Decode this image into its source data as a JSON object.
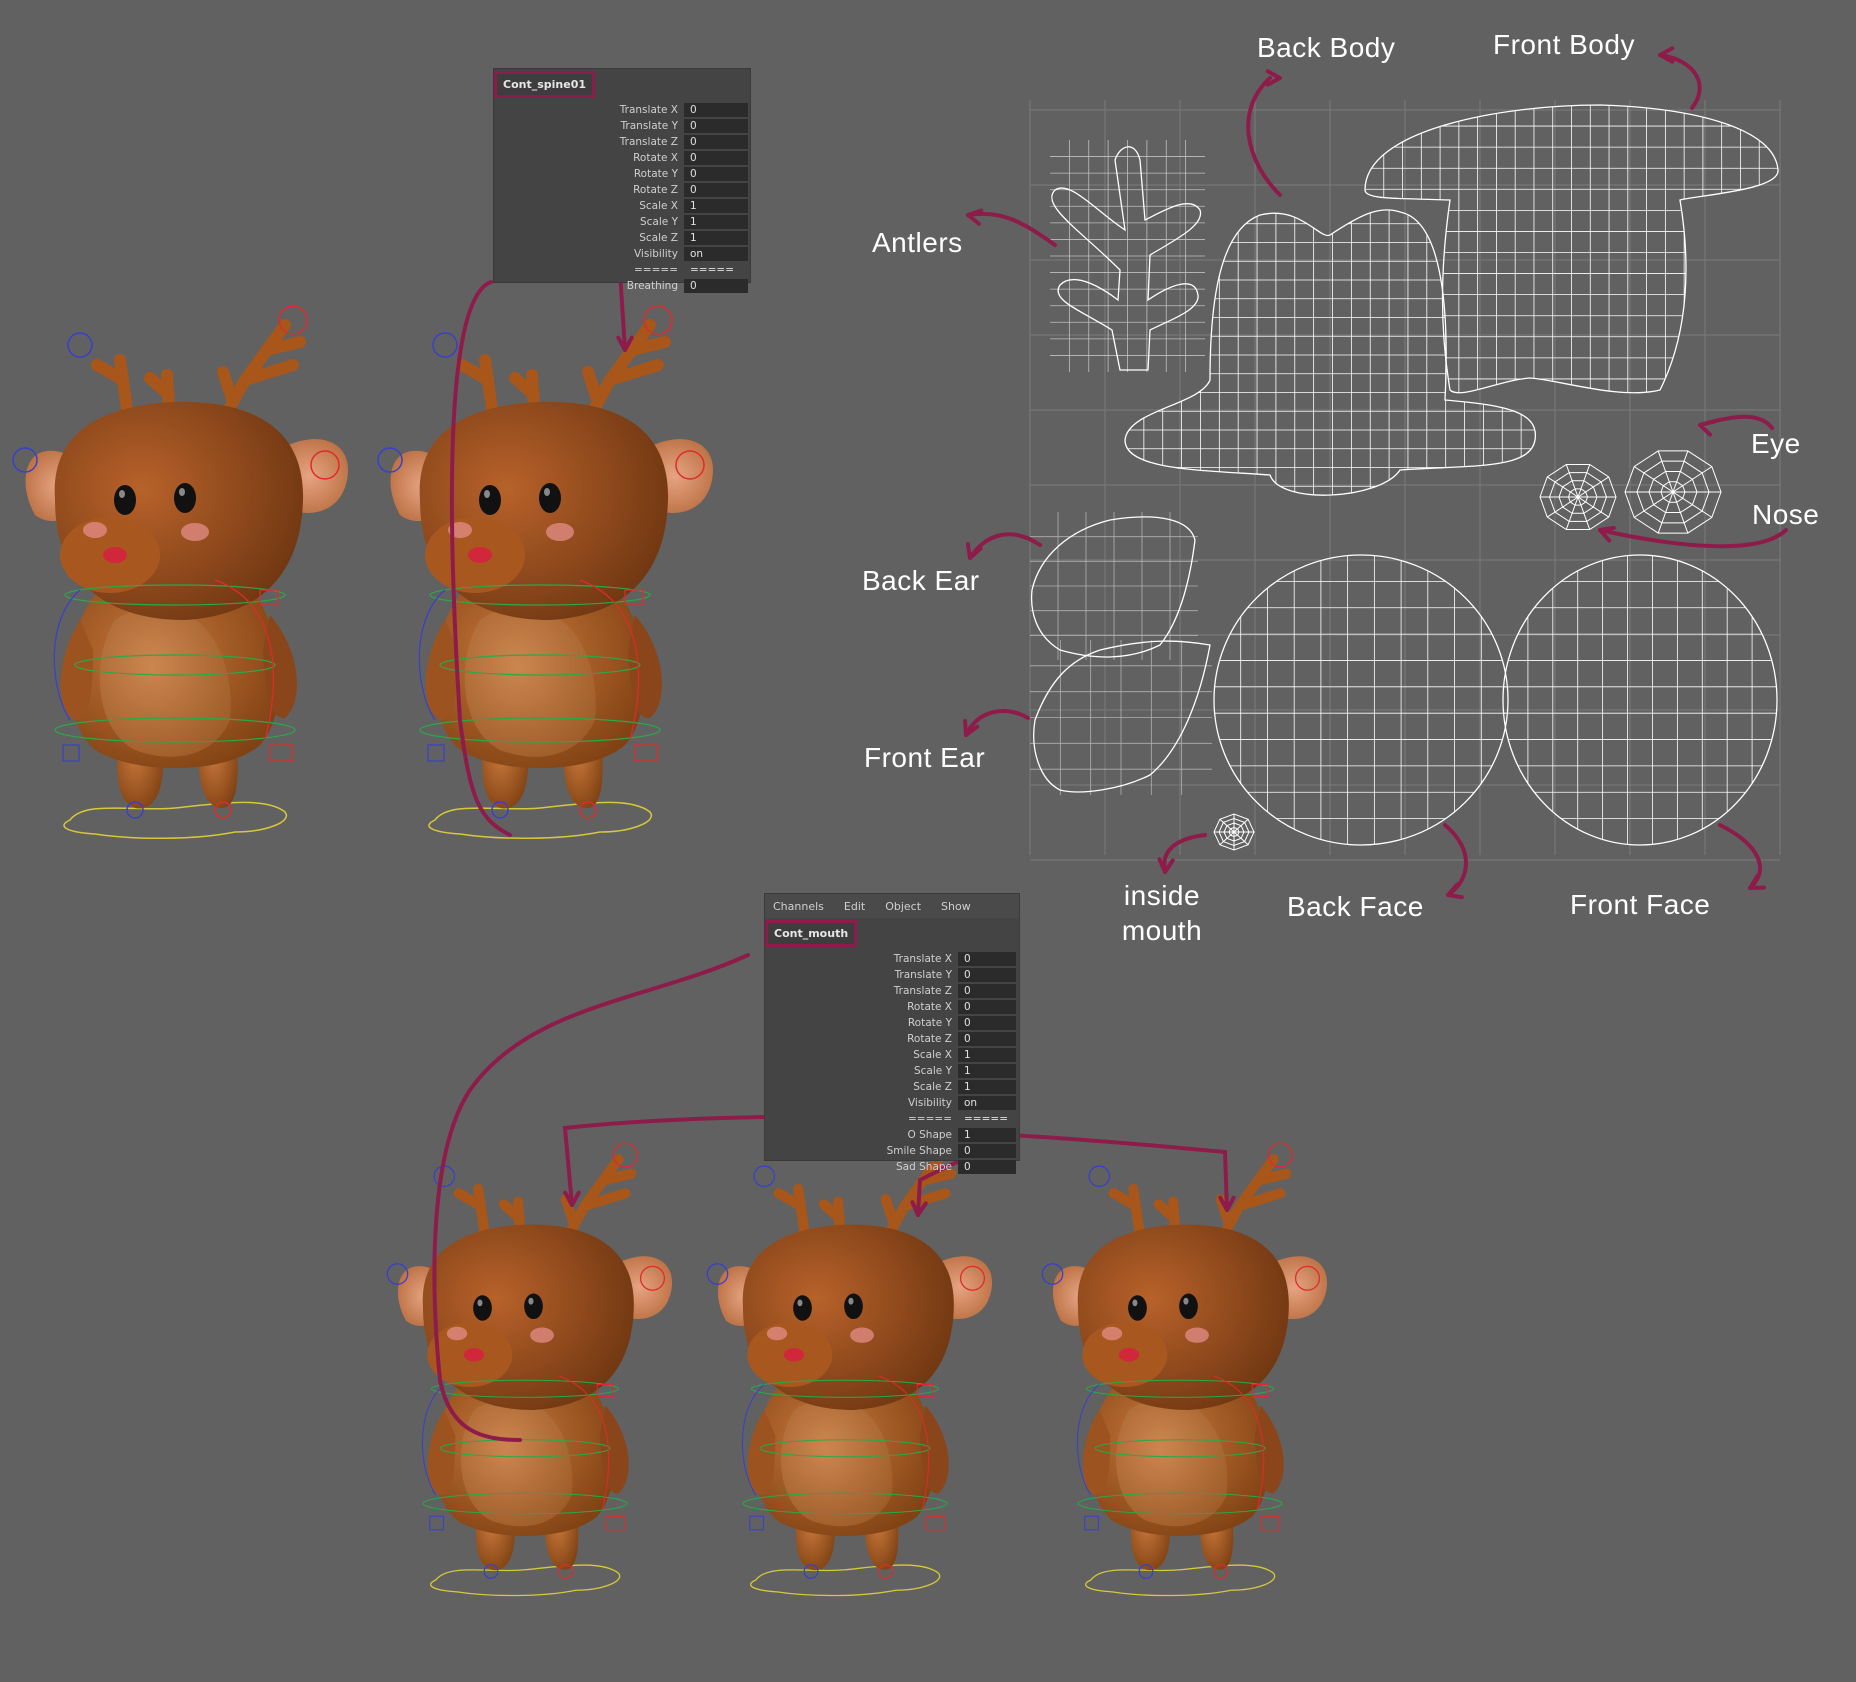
{
  "panel_spine": {
    "object_name": "Cont_spine01",
    "attributes": [
      {
        "label": "Translate X",
        "value": "0"
      },
      {
        "label": "Translate Y",
        "value": "0"
      },
      {
        "label": "Translate Z",
        "value": "0"
      },
      {
        "label": "Rotate X",
        "value": "0"
      },
      {
        "label": "Rotate Y",
        "value": "0"
      },
      {
        "label": "Rotate Z",
        "value": "0"
      },
      {
        "label": "Scale X",
        "value": "1"
      },
      {
        "label": "Scale Y",
        "value": "1"
      },
      {
        "label": "Scale Z",
        "value": "1"
      },
      {
        "label": "Visibility",
        "value": "on"
      },
      {
        "label": "=====",
        "value": "====="
      },
      {
        "label": "Breathing",
        "value": "0"
      }
    ]
  },
  "panel_mouth": {
    "menu": [
      "Channels",
      "Edit",
      "Object",
      "Show"
    ],
    "object_name": "Cont_mouth",
    "attributes": [
      {
        "label": "Translate X",
        "value": "0"
      },
      {
        "label": "Translate Y",
        "value": "0"
      },
      {
        "label": "Translate Z",
        "value": "0"
      },
      {
        "label": "Rotate X",
        "value": "0"
      },
      {
        "label": "Rotate Y",
        "value": "0"
      },
      {
        "label": "Rotate Z",
        "value": "0"
      },
      {
        "label": "Scale X",
        "value": "1"
      },
      {
        "label": "Scale Y",
        "value": "1"
      },
      {
        "label": "Scale Z",
        "value": "1"
      },
      {
        "label": "Visibility",
        "value": "on"
      },
      {
        "label": "=====",
        "value": "====="
      },
      {
        "label": "O Shape",
        "value": "1"
      },
      {
        "label": "Smile Shape",
        "value": "0"
      },
      {
        "label": "Sad Shape",
        "value": "0"
      }
    ]
  },
  "uv_labels": {
    "back_body": "Back Body",
    "front_body": "Front Body",
    "antlers": "Antlers",
    "eye": "Eye",
    "nose": "Nose",
    "back_ear": "Back Ear",
    "front_ear": "Front Ear",
    "inside_mouth_line1": "inside",
    "inside_mouth_line2": "mouth",
    "back_face": "Back Face",
    "front_face": "Front Face"
  },
  "colors": {
    "background": "#616161",
    "annotation": "#8e1c4a",
    "deer_body": "#a85b1e",
    "deer_dark": "#7a3d10",
    "uv_wire": "#ffffff"
  }
}
